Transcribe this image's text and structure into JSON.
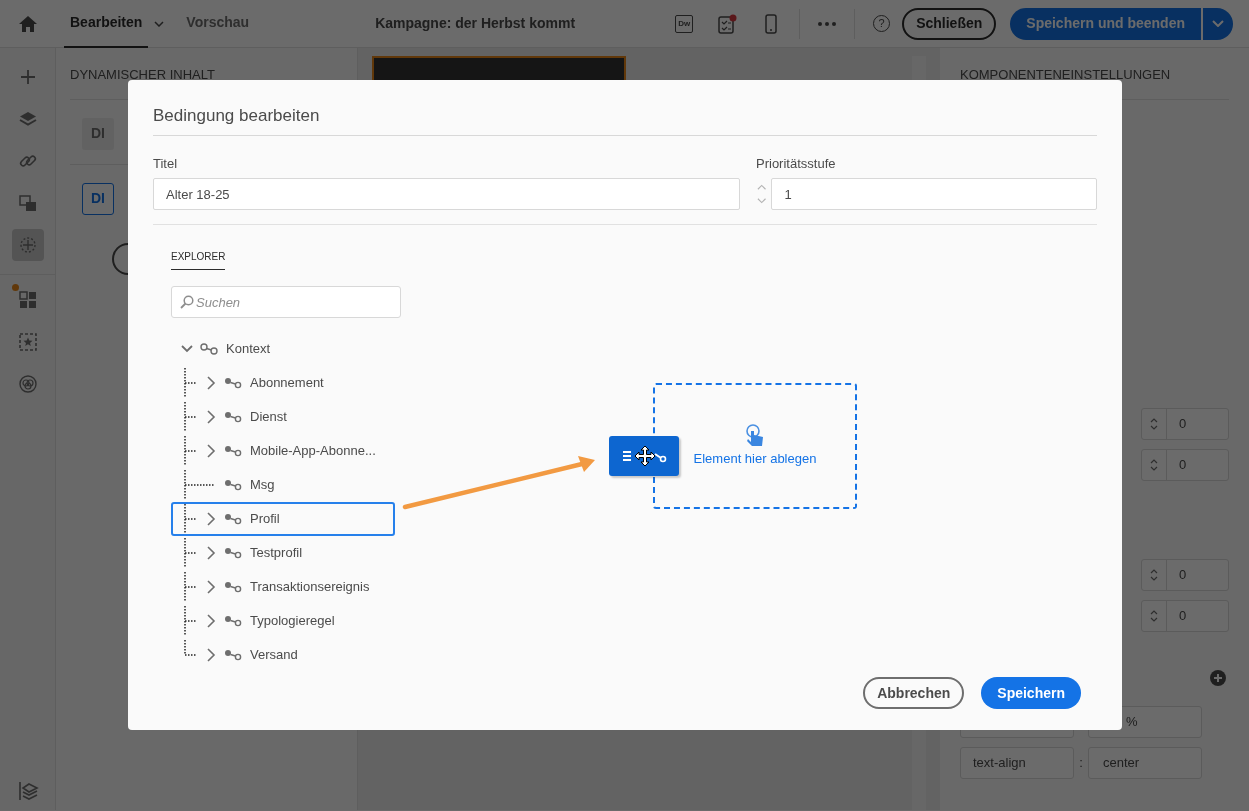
{
  "header": {
    "tabs": [
      {
        "label": "Bearbeiten",
        "selected": true,
        "has_menu": true
      },
      {
        "label": "Vorschau",
        "selected": false,
        "has_menu": false
      }
    ],
    "title": "Kampagne: der Herbst kommt",
    "toolbar": {
      "dw_label": "Dw",
      "checklist_alert": true,
      "help_label": "?"
    },
    "buttons": {
      "close": "Schließen",
      "save": "Speichern und beenden"
    }
  },
  "sidebar": {
    "items": [
      {
        "kind": "plus",
        "selected": false,
        "alert": false
      },
      {
        "kind": "layers",
        "selected": false,
        "alert": false
      },
      {
        "kind": "link",
        "selected": false,
        "alert": false
      },
      {
        "kind": "images",
        "selected": false,
        "alert": false
      },
      {
        "kind": "components",
        "selected": true,
        "alert": false
      },
      {
        "kind": "grid",
        "selected": false,
        "alert": true
      },
      {
        "kind": "star",
        "selected": false,
        "alert": false
      },
      {
        "kind": "circles",
        "selected": false,
        "alert": false
      }
    ]
  },
  "left_panel": {
    "title": "DYNAMISCHER INHALT",
    "chips": [
      {
        "label": "DI",
        "selected": false
      },
      {
        "label": "DI",
        "selected": true
      }
    ]
  },
  "right_panel": {
    "title": "KOMPONENTENEINSTELLUNGEN",
    "spinners": [
      "0",
      "0",
      "0",
      "0"
    ],
    "style_rows": [
      {
        "value": "%"
      },
      {
        "property": "text-align",
        "separator": ":",
        "value": "center"
      }
    ]
  },
  "dialog": {
    "title": "Bedingung bearbeiten",
    "title_field": {
      "label": "Titel",
      "value": "Alter 18-25"
    },
    "priority_field": {
      "label": "Prioritätsstufe",
      "value": "1"
    },
    "explorer": {
      "tab": "EXPLORER",
      "search": {
        "placeholder": "Suchen"
      },
      "tree": {
        "label": "Kontext",
        "expanded": true,
        "children": [
          {
            "label": "Abonnement",
            "expandable": true,
            "selected": false
          },
          {
            "label": "Dienst",
            "expandable": true,
            "selected": false
          },
          {
            "label": "Mobile-App-Abonne...",
            "expandable": true,
            "selected": false
          },
          {
            "label": "Msg",
            "expandable": false,
            "selected": false
          },
          {
            "label": "Profil",
            "expandable": true,
            "selected": true
          },
          {
            "label": "Testprofil",
            "expandable": true,
            "selected": false
          },
          {
            "label": "Transaktionsereignis",
            "expandable": true,
            "selected": false
          },
          {
            "label": "Typologieregel",
            "expandable": true,
            "selected": false
          },
          {
            "label": "Versand",
            "expandable": true,
            "selected": false
          }
        ]
      }
    },
    "drop_zone": {
      "label": "Element hier ablegen"
    },
    "buttons": {
      "cancel": "Abbrechen",
      "save": "Speichern"
    }
  }
}
